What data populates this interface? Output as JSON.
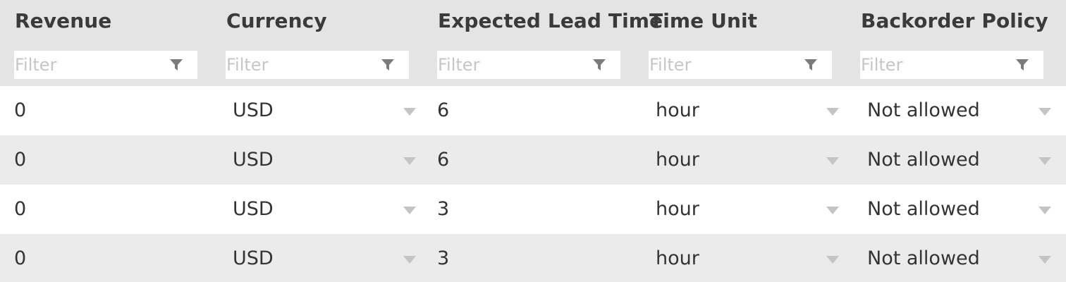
{
  "columns": [
    {
      "header": "Revenue",
      "filter_placeholder": "Filter"
    },
    {
      "header": "Currency",
      "filter_placeholder": "Filter"
    },
    {
      "header": "Expected Lead Time",
      "filter_placeholder": "Filter"
    },
    {
      "header": "Time Unit",
      "filter_placeholder": "Filter"
    },
    {
      "header": "Backorder Policy",
      "filter_placeholder": "Filter"
    }
  ],
  "rows": [
    {
      "revenue": "0",
      "currency": "USD",
      "lead_time": "6",
      "time_unit": "hour",
      "backorder_policy": "Not allowed"
    },
    {
      "revenue": "0",
      "currency": "USD",
      "lead_time": "6",
      "time_unit": "hour",
      "backorder_policy": "Not allowed"
    },
    {
      "revenue": "0",
      "currency": "USD",
      "lead_time": "3",
      "time_unit": "hour",
      "backorder_policy": "Not allowed"
    },
    {
      "revenue": "0",
      "currency": "USD",
      "lead_time": "3",
      "time_unit": "hour",
      "backorder_policy": "Not allowed"
    }
  ],
  "icons": {
    "filter": "filter-funnel-icon",
    "dropdown": "dropdown-arrow-icon"
  },
  "colors": {
    "header_bg": "#e4e4e4",
    "row_alt_bg": "#ebebeb",
    "text": "#333333",
    "placeholder": "#c6c6c6",
    "icon": "#7a7a7a"
  }
}
